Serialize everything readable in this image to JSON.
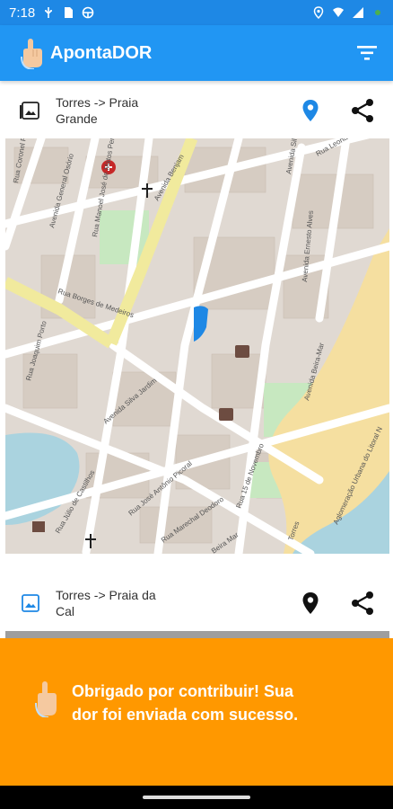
{
  "status_bar": {
    "time": "7:18",
    "left_icons": [
      "usb-icon",
      "sd-card-icon",
      "steering-icon"
    ],
    "right_icons": [
      "location-icon",
      "wifi-icon",
      "signal-icon",
      "battery-icon"
    ]
  },
  "app_bar": {
    "title": "ApontaDOR",
    "logo_icon": "hand-pointing-icon",
    "filter_icon": "filter-icon",
    "color": "#2196f3"
  },
  "cards": [
    {
      "title": "Torres -> Praia Grande",
      "thumb_icon": "image-icon",
      "location_icon": "location-pin-icon",
      "location_color": "#1e88e5",
      "share_icon": "share-icon",
      "map": {
        "streets": [
          "Rua Coronel Pa",
          "Avenida General Osório",
          "Rua Manoel José de Matos Pereir",
          "Avenida Benjam",
          "Rua Borges de Medeiros",
          "Rua Joaquim Porto",
          "Avenida Silva Jardim",
          "Rua Júlio de Castilhos",
          "Rua José Antônio Picoral",
          "Rua 15 de Novembro",
          "Rua Marechal Deodoro",
          "Beira Mar",
          "Avenida Silva J",
          "Rua Leonardo Truda",
          "Avenida Ernesto Alves",
          "Avenida Beira-Mar",
          "Aglomeração Urbana do Litoral N",
          "Torres"
        ]
      }
    },
    {
      "title": "Torres -> Praia da Cal",
      "thumb_icon": "image-icon",
      "location_icon": "location-pin-icon",
      "location_color": "#111111",
      "share_icon": "share-icon"
    }
  ],
  "toast": {
    "message": "Obrigado por contribuir! Sua dor foi enviada com sucesso.",
    "icon": "hand-pointing-icon",
    "color": "#ff9800"
  }
}
